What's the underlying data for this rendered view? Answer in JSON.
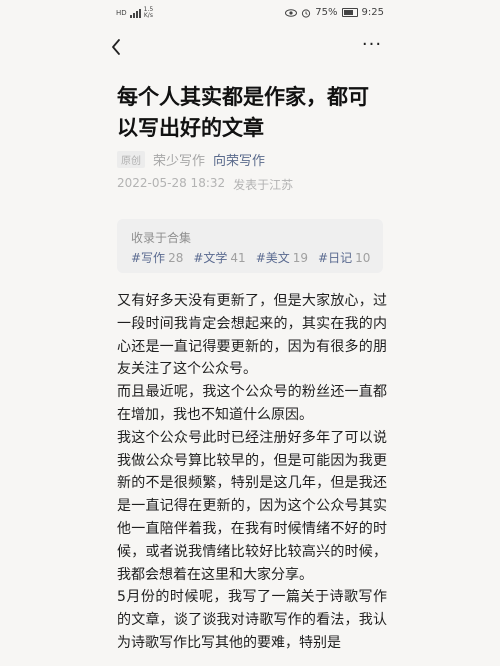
{
  "status_bar": {
    "left_icons": "HD",
    "speed_value": "1.5",
    "speed_unit": "K/s",
    "battery": "75%",
    "time": "9:25"
  },
  "nav": {
    "back_icon": "chevron-left-icon",
    "more_label": "···"
  },
  "article": {
    "title": "每个人其实都是作家，都可以写出好的文章",
    "badge": "原创",
    "author": "荣少写作",
    "account": "向荣写作",
    "date": "2022-05-28 18:32",
    "location": "发表于江苏",
    "collection": {
      "label": "收录于合集",
      "tags": [
        {
          "name": "#写作",
          "count": "28"
        },
        {
          "name": "#文学",
          "count": "41"
        },
        {
          "name": "#美文",
          "count": "19"
        },
        {
          "name": "#日记",
          "count": "10"
        }
      ]
    },
    "paragraphs": [
      "又有好多天没有更新了，但是大家放心，过一段时间我肯定会想起来的，其实在我的内心还是一直记得要更新的，因为有很多的朋友关注了这个公众号。",
      "而且最近呢，我这个公众号的粉丝还一直都在增加，我也不知道什么原因。",
      "我这个公众号此时已经注册好多年了可以说我做公众号算比较早的，但是可能因为我更新的不是很频繁，特别是这几年，但是我还是一直记得在更新的，因为这个公众号其实他一直陪伴着我，在我有时候情绪不好的时候，或者说我情绪比较好比较高兴的时候，我都会想着在这里和大家分享。",
      "5月份的时候呢，我写了一篇关于诗歌写作的文章，谈了谈我对诗歌写作的看法，我认为诗歌写作比写其他的要难，特别是"
    ]
  }
}
